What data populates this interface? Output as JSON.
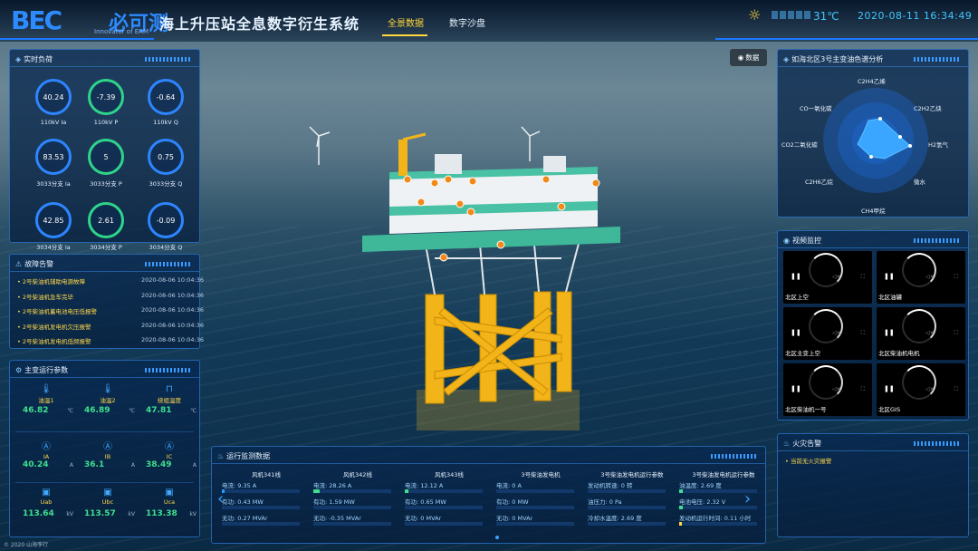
{
  "header": {
    "logo": "BEC",
    "logo_cn": "必可测",
    "logo_tagline": "Innovator of EAM",
    "system_title": "海上升压站全息数字衍生系统",
    "tabs": [
      "全景数据",
      "数字沙盘"
    ],
    "active_tab": "全景数据",
    "temperature": "31℃",
    "datetime": "2020-08-11 16:34:49",
    "weather_icon": "sun-icon"
  },
  "data_button": "数据",
  "realtime_load": {
    "title": "实时负荷",
    "gauges": [
      {
        "value": "40.24",
        "label": "110kV Ia",
        "color": "blue"
      },
      {
        "value": "-7.39",
        "label": "110kV P",
        "color": "green"
      },
      {
        "value": "-0.64",
        "label": "110kV Q",
        "color": "blue"
      },
      {
        "value": "83.53",
        "label": "3033分支 Ia",
        "color": "blue"
      },
      {
        "value": "5",
        "label": "3033分支 P",
        "color": "green"
      },
      {
        "value": "0.75",
        "label": "3033分支 Q",
        "color": "blue"
      },
      {
        "value": "42.85",
        "label": "3034分支 Ia",
        "color": "blue"
      },
      {
        "value": "2.61",
        "label": "3034分支 P",
        "color": "green"
      },
      {
        "value": "-0.09",
        "label": "3034分支 Q",
        "color": "blue"
      }
    ]
  },
  "fault_alarm": {
    "title": "故障告警",
    "items": [
      {
        "text": "2号柴油机辅助电源故障",
        "time": "2020-08-06 10:04:36"
      },
      {
        "text": "2号柴油机急车完毕",
        "time": "2020-08-06 10:04:36"
      },
      {
        "text": "2号柴油机蓄电池电压低报警",
        "time": "2020-08-06 10:04:36"
      },
      {
        "text": "2号柴油机发电机欠压报警",
        "time": "2020-08-06 10:04:36"
      },
      {
        "text": "2号柴油机发电机低频报警",
        "time": "2020-08-06 10:04:36"
      }
    ]
  },
  "transformer_params": {
    "title": "主变运行参数",
    "cells": [
      {
        "icon": "thermometer-icon",
        "name": "油温1",
        "value": "46.82",
        "unit": "℃"
      },
      {
        "icon": "thermometer-icon",
        "name": "油温2",
        "value": "46.89",
        "unit": "℃"
      },
      {
        "icon": "winding-icon",
        "name": "绕组温度",
        "value": "47.81",
        "unit": "℃"
      },
      {
        "icon": "ammeter-icon",
        "name": "IA",
        "value": "40.24",
        "unit": "A"
      },
      {
        "icon": "ammeter-icon",
        "name": "IB",
        "value": "36.1",
        "unit": "A"
      },
      {
        "icon": "ammeter-icon",
        "name": "IC",
        "value": "38.49",
        "unit": "A"
      },
      {
        "icon": "voltmeter-icon",
        "name": "Uab",
        "value": "113.64",
        "unit": "kV"
      },
      {
        "icon": "voltmeter-icon",
        "name": "Ubc",
        "value": "113.57",
        "unit": "kV"
      },
      {
        "icon": "voltmeter-icon",
        "name": "Uca",
        "value": "113.38",
        "unit": "kV"
      }
    ]
  },
  "operation_monitor": {
    "title": "运行监测数据",
    "columns": [
      {
        "head": "风机341线",
        "lines": [
          {
            "text": "电流: 9.35 A",
            "fill": 0.04,
            "tone": "b"
          },
          {
            "text": "有功: 0.43 MW",
            "fill": 0.0,
            "tone": "b"
          },
          {
            "text": "无功: 0.27 MVAr",
            "fill": 0.0,
            "tone": "b"
          }
        ]
      },
      {
        "head": "风机342线",
        "lines": [
          {
            "text": "电流: 28.26 A",
            "fill": 0.08,
            "tone": "g"
          },
          {
            "text": "有功: 1.59 MW",
            "fill": 0.0,
            "tone": "b"
          },
          {
            "text": "无功: -0.35 MVAr",
            "fill": 0.0,
            "tone": "b"
          }
        ]
      },
      {
        "head": "风机343线",
        "lines": [
          {
            "text": "电流: 12.12 A",
            "fill": 0.05,
            "tone": "g"
          },
          {
            "text": "有功: 0.65 MW",
            "fill": 0.0,
            "tone": "b"
          },
          {
            "text": "无功: 0 MVAr",
            "fill": 0.0,
            "tone": "b"
          }
        ]
      },
      {
        "head": "3号柴油发电机",
        "lines": [
          {
            "text": "电流: 0 A",
            "fill": 0.0,
            "tone": "b"
          },
          {
            "text": "有功: 0 MW",
            "fill": 0.0,
            "tone": "b"
          },
          {
            "text": "无功: 0 MVAr",
            "fill": 0.0,
            "tone": "b"
          }
        ]
      },
      {
        "head": "3号柴油发电机运行参数",
        "lines": [
          {
            "text": "发动机转速: 0 转",
            "fill": 0.0,
            "tone": "b"
          },
          {
            "text": "油压力: 0 Pa",
            "fill": 0.0,
            "tone": "b"
          },
          {
            "text": "冷却水温度: 2.69 度",
            "fill": 0.0,
            "tone": "b"
          }
        ]
      },
      {
        "head": "3号柴油发电机运行参数",
        "lines": [
          {
            "text": "油温度: 2.69 度",
            "fill": 0.05,
            "tone": "g"
          },
          {
            "text": "电池电压: 2.32 V",
            "fill": 0.05,
            "tone": "g"
          },
          {
            "text": "发动机运行时间: 0.11 小时",
            "fill": 0.03,
            "tone": "y"
          }
        ]
      }
    ]
  },
  "gas_analysis": {
    "title": "如海北区3号主变油色谱分析",
    "labels": [
      "C2H4乙烯",
      "C2H2乙炔",
      "H2氢气",
      "微水",
      "CH4甲烷",
      "C2H6乙烷",
      "CO2二氧化碳",
      "CO一氧化碳"
    ]
  },
  "video_monitor": {
    "title": "视频监控",
    "cameras": [
      "北区上空",
      "北区油罐",
      "北区主变上空",
      "北区柴油机电机",
      "北区柴油机一号",
      "北区GIS"
    ]
  },
  "fire_alarm": {
    "title": "火灾告警",
    "status": "当前无火灾报警"
  },
  "footer": {
    "copyright": "© 2020 山海孪行"
  }
}
